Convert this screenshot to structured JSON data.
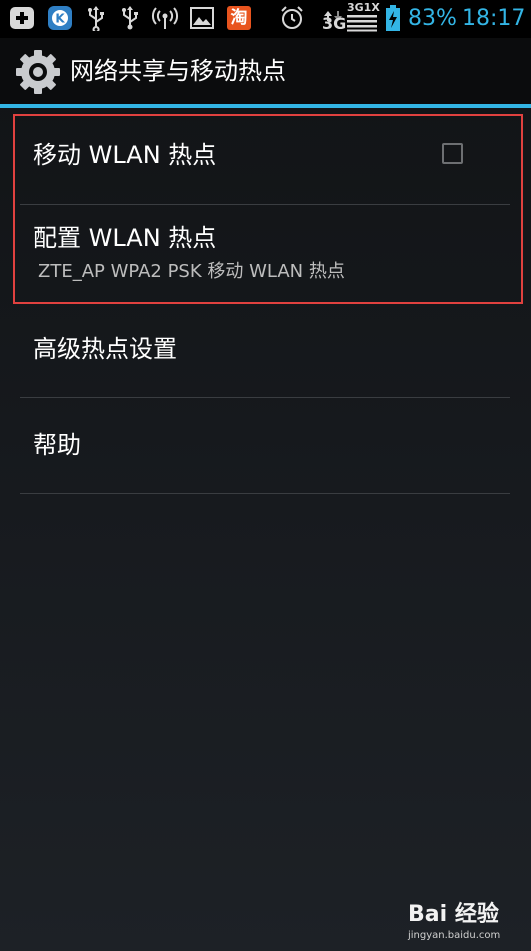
{
  "status_bar": {
    "notifications": [
      "plus-icon",
      "k-app-icon",
      "usb-icon",
      "usb-icon",
      "hotspot-signal-icon",
      "gallery-icon",
      "taobao-icon"
    ],
    "taobao_label": "淘",
    "network_type": "3G",
    "network_sub": "3G1X",
    "battery_percent": "83%",
    "time": "18:17",
    "colors": {
      "accent": "#33b5e5",
      "taobao": "#e8541e",
      "k_app": "#2f7fc4"
    }
  },
  "action_bar": {
    "icon": "settings-gear-icon",
    "title": "网络共享与移动热点"
  },
  "preferences": {
    "items": [
      {
        "title": "移动 WLAN 热点",
        "checked": false
      },
      {
        "title": "配置 WLAN 热点",
        "summary": "ZTE_AP WPA2 PSK 移动 WLAN 热点"
      },
      {
        "title": "高级热点设置"
      },
      {
        "title": "帮助"
      }
    ]
  },
  "watermark": {
    "logo": "Bai 经验",
    "url": "jingyan.baidu.com"
  }
}
